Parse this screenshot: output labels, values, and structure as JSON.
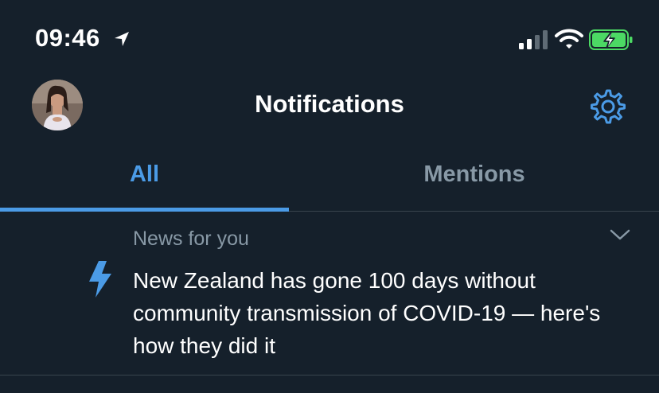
{
  "status_bar": {
    "time": "09:46",
    "icons": [
      "location-arrow-icon",
      "cellular-signal-icon",
      "wifi-icon",
      "battery-charging-icon"
    ],
    "battery_color": "#4cd964"
  },
  "header": {
    "title": "Notifications",
    "settings_icon": "gear-icon",
    "accent_color": "#4b9be6"
  },
  "tabs": [
    {
      "label": "All",
      "selected": true
    },
    {
      "label": "Mentions",
      "selected": false
    }
  ],
  "notification": {
    "label": "News for you",
    "headline": "New Zealand has gone 100 days without community transmission of COVID-19 — here's how they did it",
    "icon": "lightning-bolt-icon",
    "menu_icon": "chevron-down-icon"
  },
  "theme": {
    "background": "#15202b",
    "divider": "#38444d",
    "secondary_text": "#8899a6"
  }
}
